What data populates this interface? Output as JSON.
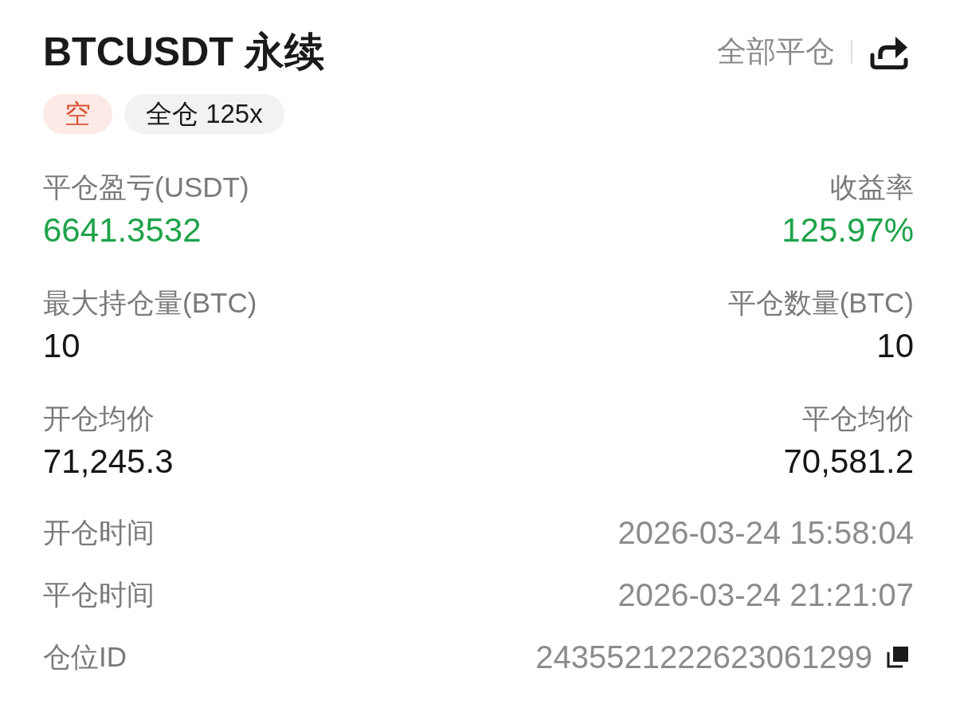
{
  "header": {
    "title": "BTCUSDT 永续",
    "close_all": "全部平仓"
  },
  "tags": [
    {
      "label": "空",
      "kind": "side"
    },
    {
      "label": "全仓 125x",
      "kind": "margin"
    }
  ],
  "stats": [
    {
      "left": {
        "label": "平仓盈亏(USDT)",
        "value": "6641.3532",
        "kind": "profit"
      },
      "right": {
        "label": "收益率",
        "value": "125.97%",
        "kind": "profit"
      }
    },
    {
      "left": {
        "label": "最大持仓量(BTC)",
        "value": "10",
        "kind": "plain"
      },
      "right": {
        "label": "平仓数量(BTC)",
        "value": "10",
        "kind": "plain"
      }
    },
    {
      "left": {
        "label": "开仓均价",
        "value": "71,245.3",
        "kind": "plain"
      },
      "right": {
        "label": "平仓均价",
        "value": "70,581.2",
        "kind": "plain"
      }
    }
  ],
  "details": [
    {
      "label": "开仓时间",
      "value": "2026-03-24 15:58:04",
      "copyable": false
    },
    {
      "label": "平仓时间",
      "value": "2026-03-24 21:21:07",
      "copyable": false
    },
    {
      "label": "仓位ID",
      "value": "2435521222623061299",
      "copyable": true
    }
  ]
}
